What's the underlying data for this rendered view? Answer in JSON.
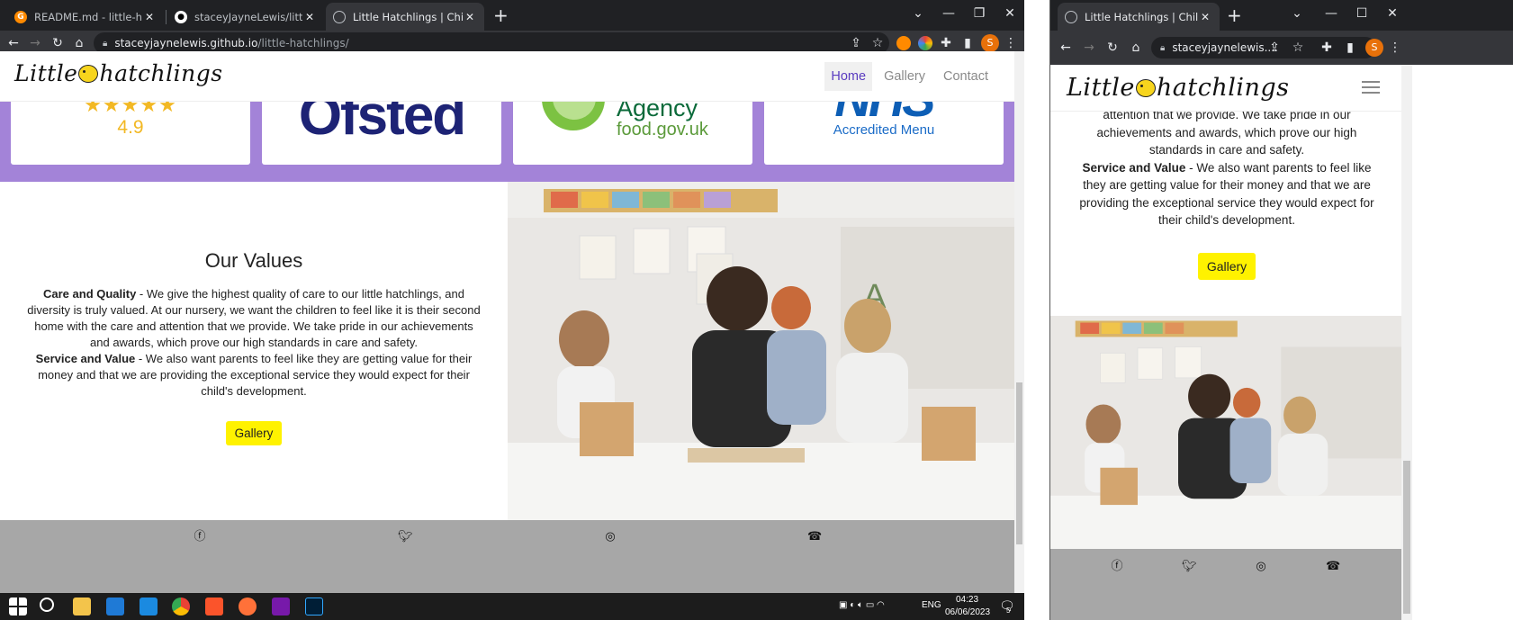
{
  "left_window": {
    "tabs": [
      {
        "title": "README.md - little-hatchlings - G",
        "icon": "gitpod-icon",
        "active": false
      },
      {
        "title": "staceyJayneLewis/little-hatchlings",
        "icon": "github-icon",
        "active": false
      },
      {
        "title": "Little Hatchlings | Childcare Nurs",
        "icon": "globe-icon",
        "active": true
      }
    ],
    "address": {
      "host": "staceyjaynelewis.github.io",
      "path": "/little-hatchlings/"
    }
  },
  "right_window": {
    "tabs": [
      {
        "title": "Little Hatchlings | Childcare N",
        "icon": "globe-icon",
        "active": true
      }
    ],
    "address": {
      "host": "staceyjaynelewis...."
    }
  },
  "site": {
    "logo": {
      "left": "Little",
      "right": "hatchlings"
    },
    "nav": {
      "home": "Home",
      "gallery": "Gallery",
      "contact": "Contact"
    },
    "accreditations": {
      "rating": "4.9",
      "stars": "★★★★★",
      "ofsted": "Ofsted",
      "fsa_line1": "Agency",
      "fsa_line2": "food.gov.uk",
      "nhs": "NHS",
      "nhs_sub": "Accredited Menu"
    },
    "values": {
      "heading": "Our Values",
      "care_title": "Care and Quality",
      "care_text": " - We give the highest quality of care to our little hatchlings, and diversity is truly valued. At our nursery, we want the children to feel like it is their second home with the care and attention that we provide. We take pride in our achievements and awards, which prove our high standards in care and safety.",
      "service_title": "Service and Value",
      "service_text": " - We also want parents to feel like they are getting value for their money and that we are providing the exceptional service they would expect for their child's development.",
      "button": "Gallery"
    },
    "mobile_values": {
      "line_partial": "attention that we provide. We take pride in our achievements and awards, which prove our high standards in care and safety.",
      "service_title": "Service and Value",
      "service_text": " - We also want parents to feel like they are getting value for their money and that we are providing the exceptional service they would expect for their child's development.",
      "button": "Gallery"
    },
    "footer_icons": [
      "facebook-icon",
      "twitter-icon",
      "instagram-icon",
      "phone-icon"
    ]
  },
  "taskbar": {
    "language": "ENG",
    "time": "04:23",
    "date": "06/06/2023",
    "notifications": "5"
  },
  "colors": {
    "brand_purple": "#a383d8",
    "button_yellow": "#fff200",
    "footer_grey": "#a7a7a7",
    "nav_active": "#5a3cc0"
  }
}
